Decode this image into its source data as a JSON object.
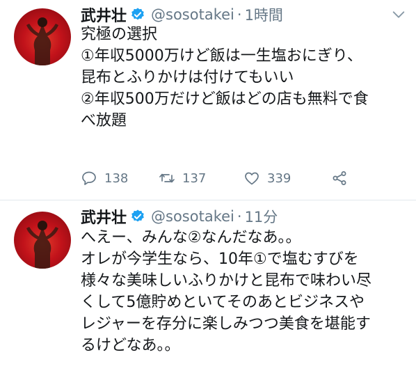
{
  "tweets": [
    {
      "author": "武井壮",
      "handle": "@sosotakei",
      "separator": "·",
      "time": "1時間",
      "lines": [
        "究極の選択",
        "①年収5000万けど飯は一生塩おにぎり、",
        "昆布とふりかけは付けてもいい",
        "②年収500万だけど飯はどの店も無料で食",
        "べ放題"
      ],
      "replies": "138",
      "retweets": "137",
      "likes": "339"
    },
    {
      "author": "武井壮",
      "handle": "@sosotakei",
      "separator": "·",
      "time": "11分",
      "lines": [
        "へえー、みんな②なんだなあ。。",
        "オレが今学生なら、10年①で塩むすびを",
        "様々な美味しいふりかけと昆布で味わい尽",
        "くして5億貯めといてそのあとビジネスや",
        "レジャーを存分に楽しみつつ美食を堪能す",
        "るけどなあ。。"
      ]
    }
  ],
  "icons": {
    "verified": "verified-badge-icon",
    "caret": "chevron-down-icon",
    "reply": "reply-icon",
    "retweet": "retweet-icon",
    "like": "heart-icon",
    "share": "share-icon"
  },
  "colors": {
    "text": "#14171a",
    "secondary": "#657786",
    "verified": "#1da1f2",
    "avatar_bg": "#c1121a",
    "divider": "#e1e8ed"
  }
}
